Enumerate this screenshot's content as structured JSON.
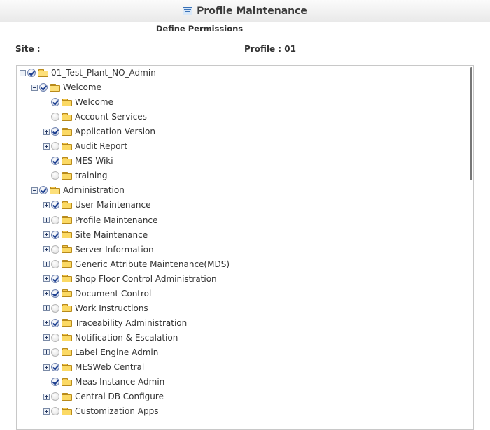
{
  "window": {
    "title": "Profile Maintenance"
  },
  "header": {
    "subtitle": "Define Permissions",
    "site_label": "Site :",
    "profile_label": "Profile : 01"
  },
  "tree": [
    {
      "label": "01_Test_Plant_NO_Admin",
      "level": 0,
      "expander": "minus",
      "checked": true,
      "folder": "open"
    },
    {
      "label": "Welcome",
      "level": 1,
      "expander": "minus",
      "checked": true,
      "folder": "open"
    },
    {
      "label": "Welcome",
      "level": 2,
      "expander": "none",
      "checked": true,
      "folder": "closed"
    },
    {
      "label": "Account Services",
      "level": 2,
      "expander": "none",
      "checked": false,
      "folder": "closed"
    },
    {
      "label": "Application Version",
      "level": 2,
      "expander": "plus",
      "checked": true,
      "folder": "closed"
    },
    {
      "label": "Audit Report",
      "level": 2,
      "expander": "plus",
      "checked": false,
      "folder": "closed"
    },
    {
      "label": "MES Wiki",
      "level": 2,
      "expander": "none",
      "checked": true,
      "folder": "closed"
    },
    {
      "label": "training",
      "level": 2,
      "expander": "none",
      "checked": false,
      "folder": "closed"
    },
    {
      "label": "Administration",
      "level": 1,
      "expander": "minus",
      "checked": true,
      "folder": "open"
    },
    {
      "label": "User Maintenance",
      "level": 2,
      "expander": "plus",
      "checked": true,
      "folder": "closed"
    },
    {
      "label": "Profile Maintenance",
      "level": 2,
      "expander": "plus",
      "checked": false,
      "folder": "closed"
    },
    {
      "label": "Site Maintenance",
      "level": 2,
      "expander": "plus",
      "checked": true,
      "folder": "closed"
    },
    {
      "label": "Server Information",
      "level": 2,
      "expander": "plus",
      "checked": false,
      "folder": "closed"
    },
    {
      "label": "Generic Attribute Maintenance(MDS)",
      "level": 2,
      "expander": "plus",
      "checked": false,
      "folder": "closed"
    },
    {
      "label": "Shop Floor Control Administration",
      "level": 2,
      "expander": "plus",
      "checked": true,
      "folder": "closed"
    },
    {
      "label": "Document Control",
      "level": 2,
      "expander": "plus",
      "checked": true,
      "folder": "closed"
    },
    {
      "label": "Work Instructions",
      "level": 2,
      "expander": "plus",
      "checked": false,
      "folder": "closed"
    },
    {
      "label": "Traceability Administration",
      "level": 2,
      "expander": "plus",
      "checked": true,
      "folder": "closed"
    },
    {
      "label": "Notification & Escalation",
      "level": 2,
      "expander": "plus",
      "checked": false,
      "folder": "closed"
    },
    {
      "label": "Label Engine Admin",
      "level": 2,
      "expander": "plus",
      "checked": false,
      "folder": "closed"
    },
    {
      "label": "MESWeb Central",
      "level": 2,
      "expander": "plus",
      "checked": true,
      "folder": "closed"
    },
    {
      "label": "Meas Instance Admin",
      "level": 2,
      "expander": "none",
      "checked": true,
      "folder": "closed"
    },
    {
      "label": "Central DB Configure",
      "level": 2,
      "expander": "plus",
      "checked": false,
      "folder": "closed"
    },
    {
      "label": "Customization Apps",
      "level": 2,
      "expander": "plus",
      "checked": false,
      "folder": "closed"
    }
  ]
}
